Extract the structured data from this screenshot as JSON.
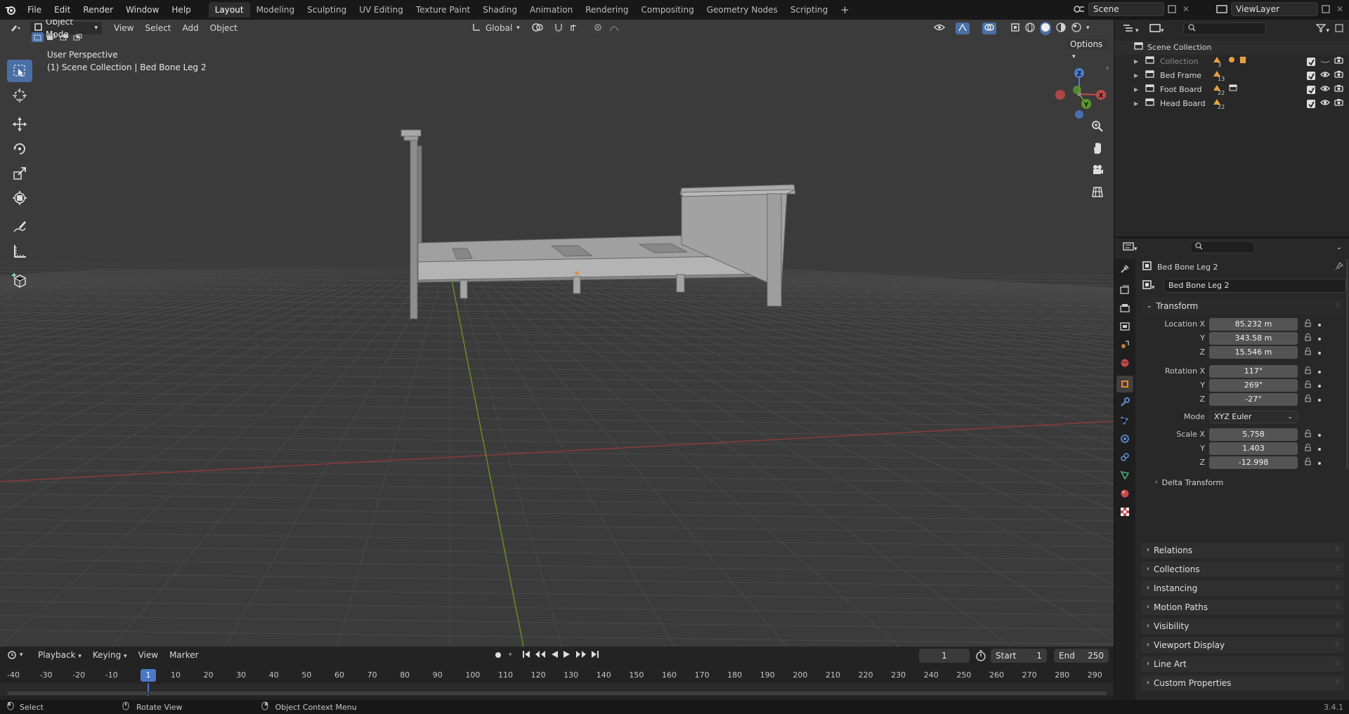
{
  "topbar": {
    "menus": [
      "File",
      "Edit",
      "Render",
      "Window",
      "Help"
    ],
    "workspaces": [
      "Layout",
      "Modeling",
      "Sculpting",
      "UV Editing",
      "Texture Paint",
      "Shading",
      "Animation",
      "Rendering",
      "Compositing",
      "Geometry Nodes",
      "Scripting"
    ],
    "active_workspace": "Layout",
    "add_workspace": "+",
    "scene_name": "Scene",
    "view_layer": "ViewLayer"
  },
  "viewport": {
    "mode": "Object Mode",
    "menus": [
      "View",
      "Select",
      "Add",
      "Object"
    ],
    "orientation": "Global",
    "options_label": "Options",
    "overlay_title": "User Perspective",
    "overlay_subtitle": "(1) Scene Collection | Bed Bone Leg 2",
    "gizmo_labels": {
      "z": "Z",
      "y": "Y",
      "x": "X"
    }
  },
  "timeline": {
    "menus": [
      "Playback",
      "Keying",
      "View",
      "Marker"
    ],
    "current_frame": "1",
    "start_label": "Start",
    "start_value": "1",
    "end_label": "End",
    "end_value": "250",
    "ticks": [
      "-40",
      "-30",
      "-20",
      "-10",
      "1",
      "10",
      "20",
      "30",
      "40",
      "50",
      "60",
      "70",
      "80",
      "90",
      "100",
      "110",
      "120",
      "130",
      "140",
      "150",
      "160",
      "170",
      "180",
      "190",
      "200",
      "210",
      "220",
      "230",
      "240",
      "250",
      "260",
      "270",
      "280",
      "290"
    ]
  },
  "statusbar": {
    "select": "Select",
    "rotate": "Rotate View",
    "context": "Object Context Menu",
    "version": "3.4.1"
  },
  "outliner": {
    "root": "Scene Collection",
    "items": [
      {
        "name": "Collection",
        "badge": "3",
        "dim": true
      },
      {
        "name": "Bed Frame",
        "badge": "13",
        "dim": false
      },
      {
        "name": "Foot Board",
        "badge": "22",
        "dim": false
      },
      {
        "name": "Head Board",
        "badge": "22",
        "dim": false
      }
    ]
  },
  "properties": {
    "object_name": "Bed Bone Leg 2",
    "datablock_name": "Bed Bone Leg 2",
    "transform_label": "Transform",
    "location": {
      "label_x": "Location X",
      "x": "85.232 m",
      "y": "343.58 m",
      "z": "15.546 m"
    },
    "rotation": {
      "label_x": "Rotation X",
      "x": "117°",
      "y": "269°",
      "z": "-27°"
    },
    "mode_label": "Mode",
    "mode_value": "XYZ Euler",
    "scale": {
      "label_x": "Scale X",
      "x": "5.758",
      "y": "1.403",
      "z": "-12.998"
    },
    "axis_y": "Y",
    "axis_z": "Z",
    "delta_transform": "Delta Transform",
    "panels": [
      "Relations",
      "Collections",
      "Instancing",
      "Motion Paths",
      "Visibility",
      "Viewport Display",
      "Line Art",
      "Custom Properties"
    ]
  }
}
